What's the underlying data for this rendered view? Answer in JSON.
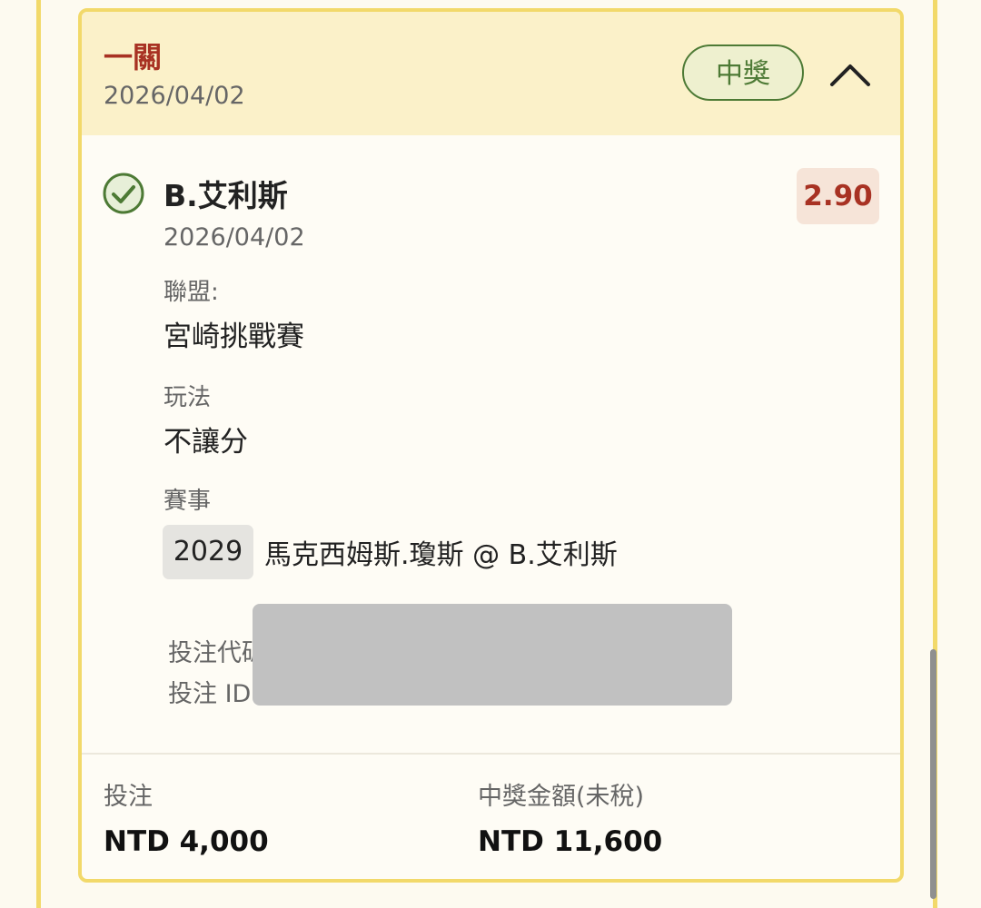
{
  "card": {
    "bet_type": "一關",
    "date": "2026/04/02",
    "status": "中獎"
  },
  "selection": {
    "name": "B.艾利斯",
    "date": "2026/04/02",
    "odds": "2.90"
  },
  "details": {
    "league_label": "聯盟:",
    "league_value": "宮崎挑戰賽",
    "play_label": "玩法",
    "play_value": "不讓分",
    "event_label": "賽事",
    "event_code": "2029",
    "event_name": "馬克西姆斯.瓊斯 @ B.艾利斯"
  },
  "meta": {
    "bet_code_label": "投注代碼",
    "bet_id_label": "投注 ID"
  },
  "summary": {
    "stake_label": "投注",
    "stake_value": "NTD 4,000",
    "payout_label": "中獎金額(未稅)",
    "payout_value": "NTD 11,600"
  },
  "icons": {
    "check": "check-circle-icon",
    "collapse": "chevron-up-icon"
  },
  "colors": {
    "accent_red": "#a83223",
    "success_green": "#4d7a35",
    "card_border": "#f2d96a",
    "header_bg": "#fbf1c9"
  }
}
